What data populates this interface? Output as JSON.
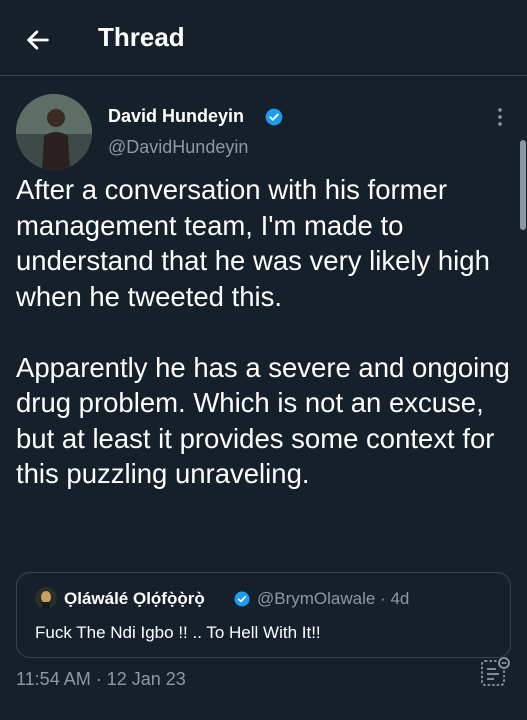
{
  "header": {
    "title": "Thread",
    "back_icon": "arrow-left-icon"
  },
  "tweet": {
    "author_name": "David Hundeyin",
    "author_handle": "@DavidHundeyin",
    "text": "After a conversation with his former management team, I'm made to understand that he was very likely high when he tweeted this.\n\nApparently he has a severe and ongoing drug problem. Which is not an excuse, but at least it provides some context for this puzzling unraveling.",
    "timestamp": "11:54 AM · 12 Jan 23"
  },
  "quote": {
    "author_name": "Ọláwálé Ọlọ́fọ̀ọ̀rọ̀",
    "author_handle": "@BrymOlawale · 4d",
    "text": "Fuck The Ndi Igbo !! .. To Hell With It!!"
  },
  "colors": {
    "background": "#15202b",
    "secondary_text": "#8b98a5",
    "verified": "#1d9bf0",
    "border": "#38444d"
  }
}
